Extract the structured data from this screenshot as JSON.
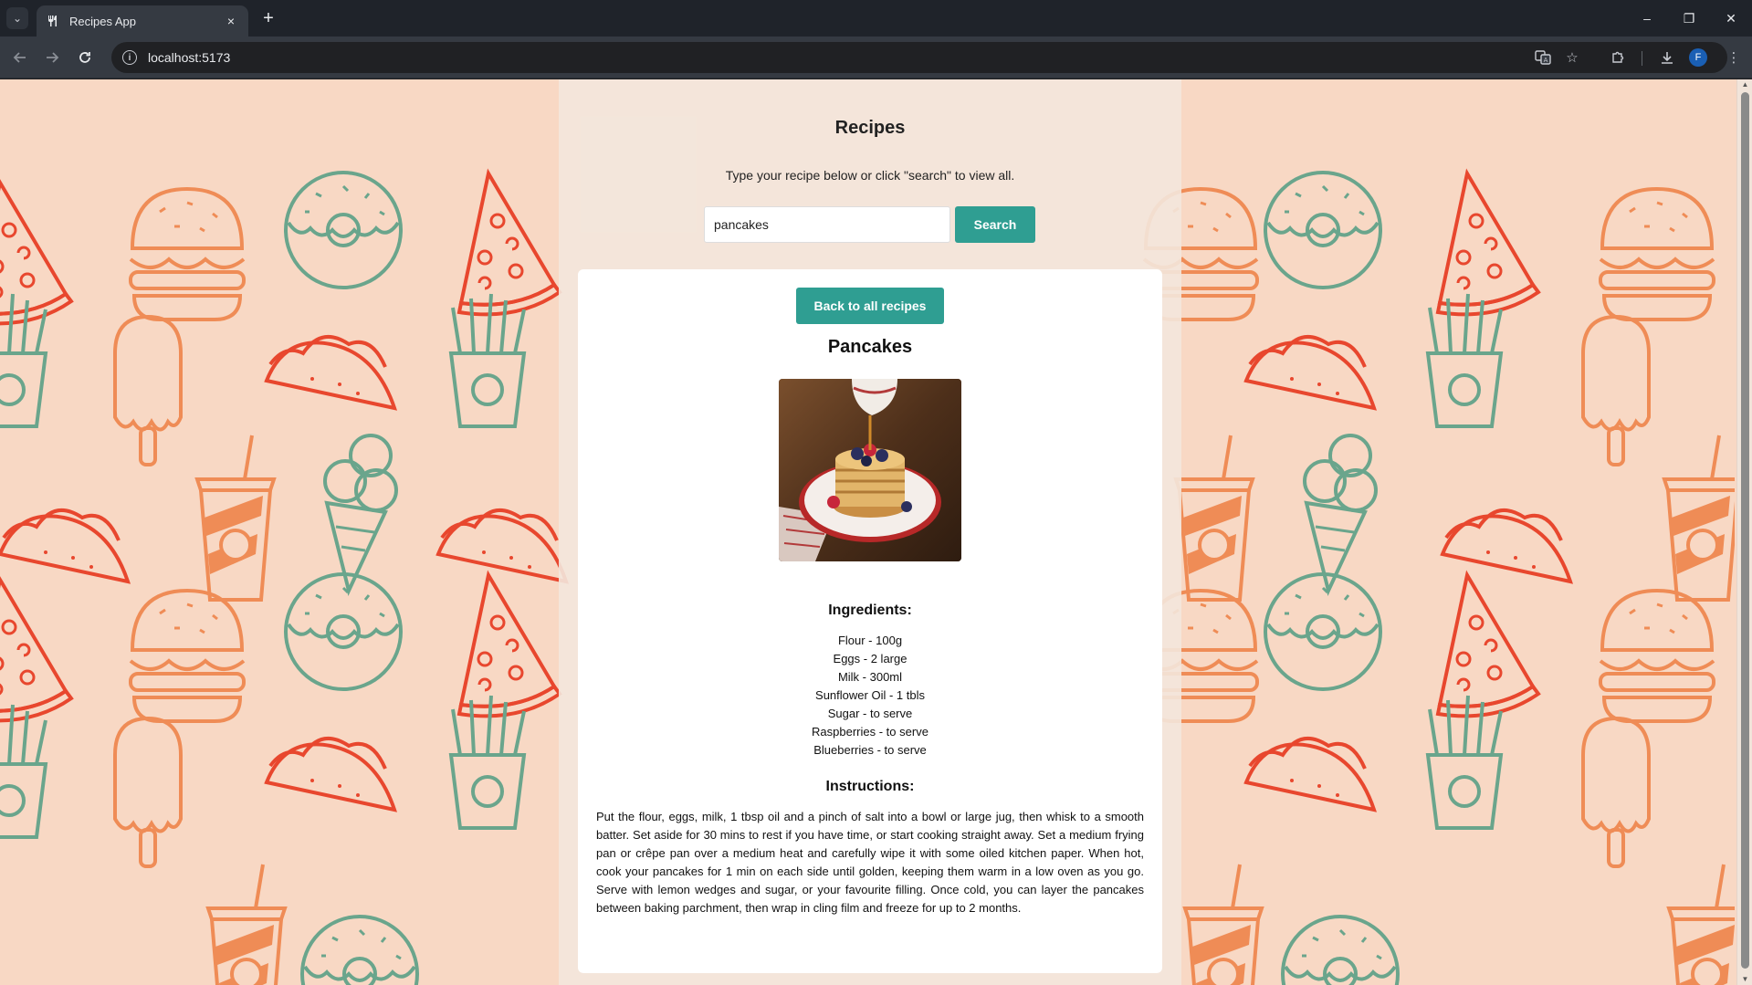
{
  "browser": {
    "tab_title": "Recipes App",
    "tab_close": "×",
    "new_tab": "+",
    "url": "localhost:5173",
    "profile_initial": "F",
    "window_controls": {
      "minimize": "–",
      "restore": "❐",
      "close": "✕"
    },
    "icons": [
      "tab-list-icon",
      "back-icon",
      "forward-icon",
      "reload-icon",
      "site-info-icon",
      "translate-icon",
      "star-icon",
      "extensions-icon",
      "download-icon",
      "menu-icon"
    ]
  },
  "app": {
    "title": "Recipes",
    "hint": "Type your recipe below or click \"search\" to view all.",
    "search": {
      "value": "pancakes",
      "button_label": "Search"
    }
  },
  "recipe": {
    "back_label": "Back to all recipes",
    "name": "Pancakes",
    "ingredients_heading": "Ingredients:",
    "ingredients": [
      "Flour - 100g",
      "Eggs - 2 large",
      "Milk - 300ml",
      "Sunflower Oil - 1 tbls",
      "Sugar - to serve",
      "Raspberries - to serve",
      "Blueberries - to serve"
    ],
    "instructions_heading": "Instructions:",
    "instructions": "Put the flour, eggs, milk, 1 tbsp oil and a pinch of salt into a bowl or large jug, then whisk to a smooth batter. Set aside for 30 mins to rest if you have time, or start cooking straight away. Set a medium frying pan or crêpe pan over a medium heat and carefully wipe it with some oiled kitchen paper. When hot, cook your pancakes for 1 min on each side until golden, keeping them warm in a low oven as you go. Serve with lemon wedges and sugar, or your favourite filling. Once cold, you can layer the pancakes between baking parchment, then wrap in cling film and freeze for up to 2 months."
  },
  "colors": {
    "accent": "#2f9e92",
    "background": "#f8d8c4",
    "pattern_orange": "#ef8c56",
    "pattern_red": "#e8472e",
    "pattern_green": "#6aa58c"
  }
}
